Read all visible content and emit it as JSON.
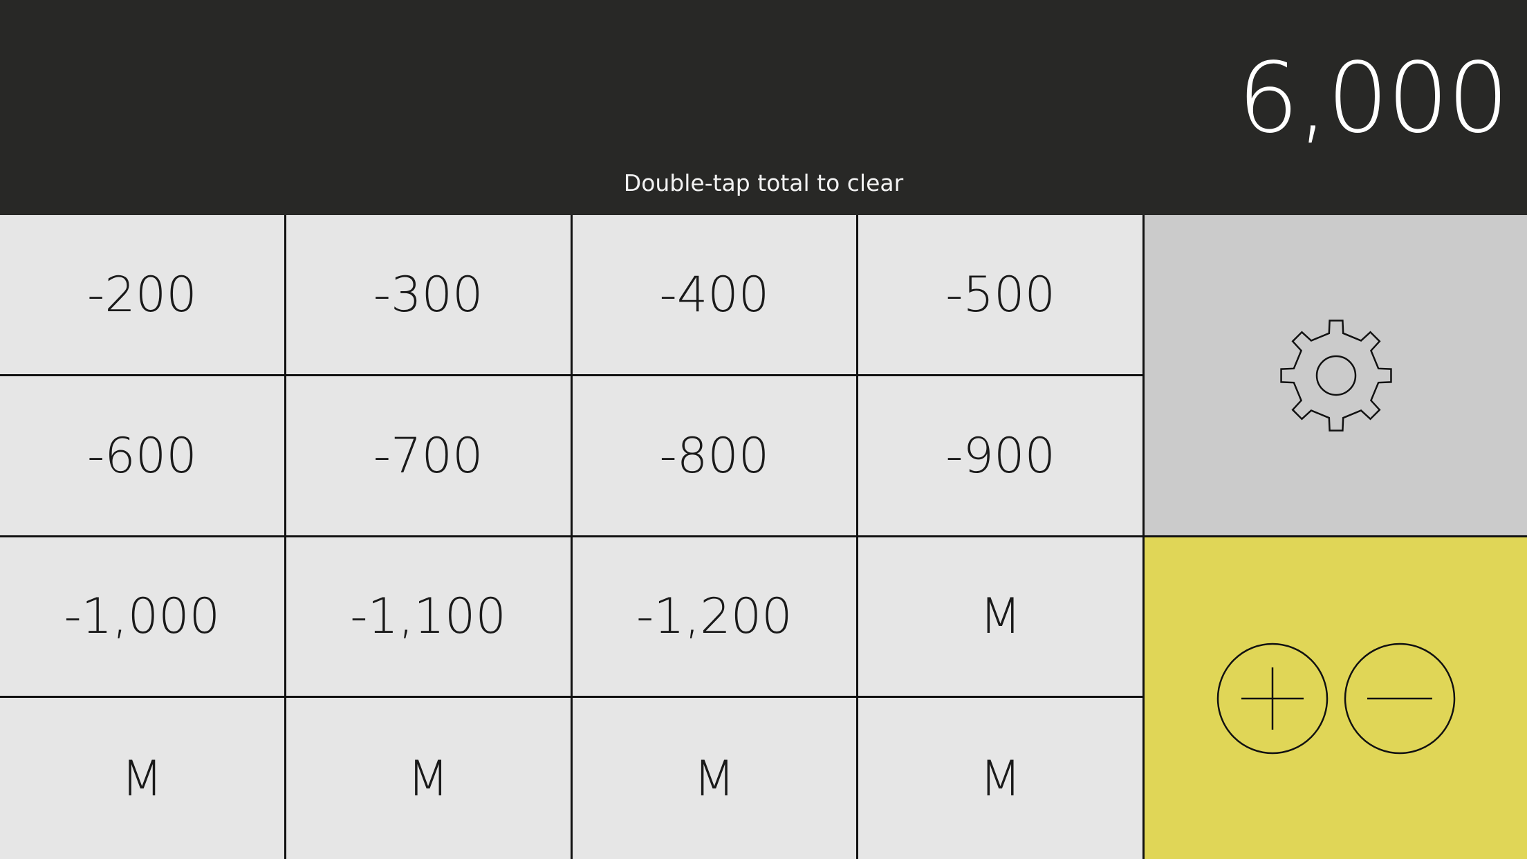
{
  "display": {
    "total": "6,000",
    "hint": "Double-tap total to clear"
  },
  "keys": [
    {
      "label": "-200"
    },
    {
      "label": "-300"
    },
    {
      "label": "-400"
    },
    {
      "label": "-500"
    },
    {
      "label": "-600"
    },
    {
      "label": "-700"
    },
    {
      "label": "-800"
    },
    {
      "label": "-900"
    },
    {
      "label": "-1,000"
    },
    {
      "label": "-1,100"
    },
    {
      "label": "-1,200"
    },
    {
      "label": "M"
    },
    {
      "label": "M"
    },
    {
      "label": "M"
    },
    {
      "label": "M"
    },
    {
      "label": "M"
    }
  ],
  "icons": {
    "settings": "gear-icon",
    "plus": "plus-circle-icon",
    "minus": "minus-circle-icon"
  },
  "colors": {
    "display_bg": "#282826",
    "key_bg": "#e6e6e6",
    "settings_bg": "#cbcbcb",
    "sign_panel_bg": "#e0d657"
  }
}
